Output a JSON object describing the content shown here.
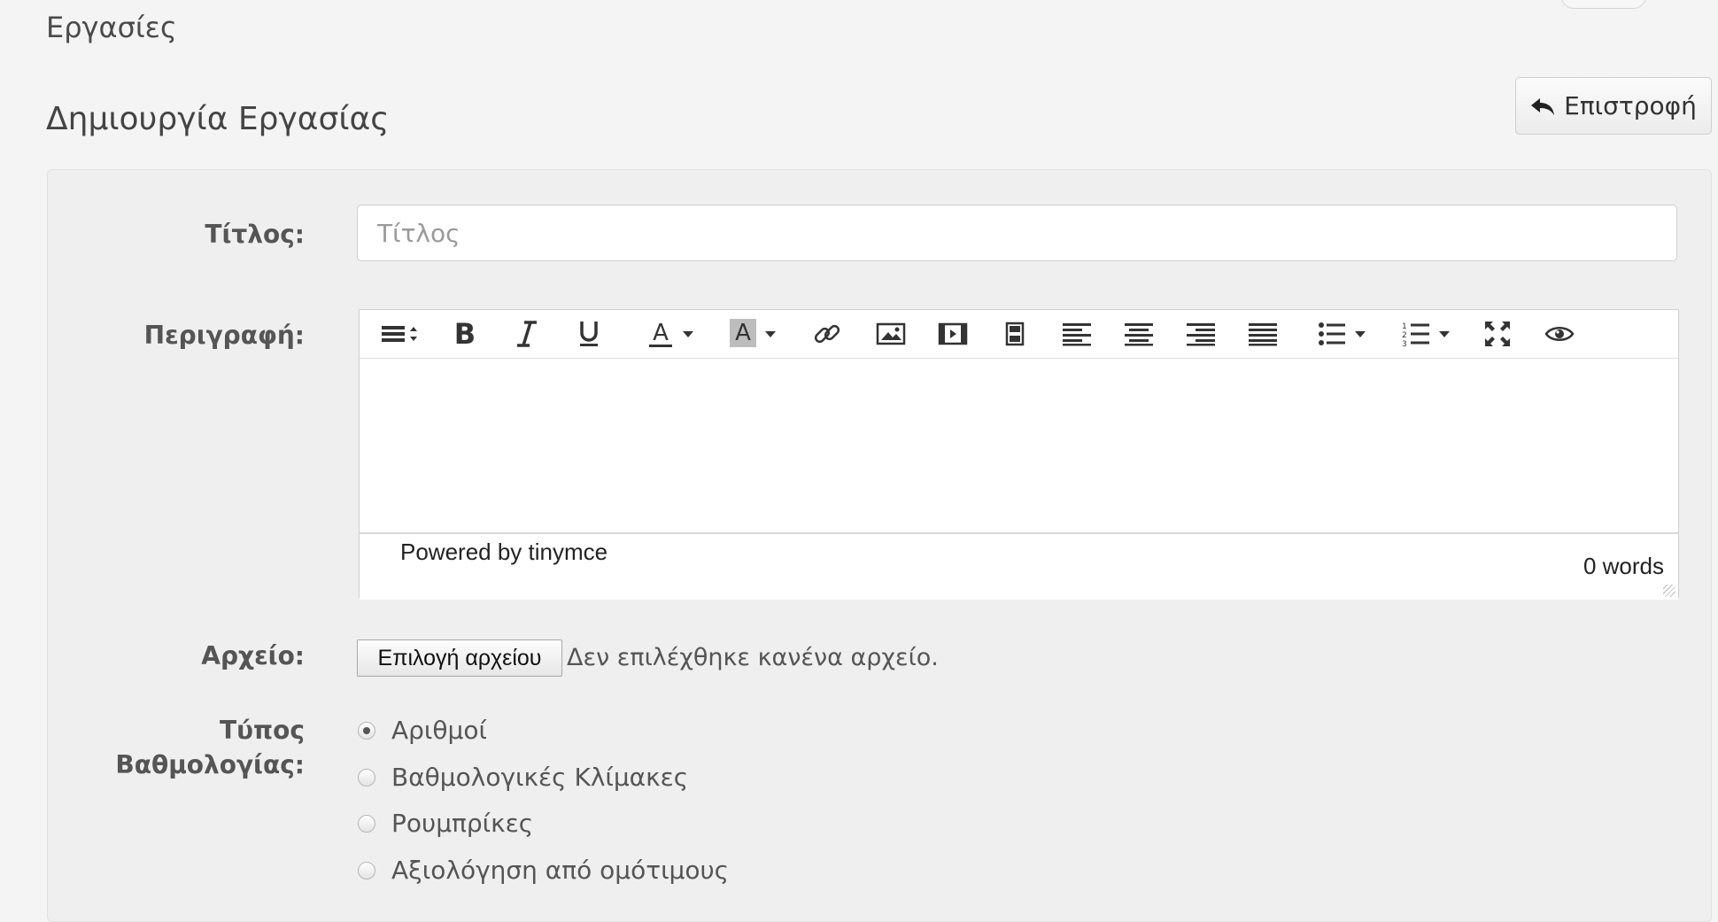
{
  "header": {
    "section_title": "Εργασίες",
    "page_title": "Δημιουργία Εργασίας",
    "back_label": "Επιστροφή"
  },
  "form": {
    "title_label": "Τίτλος:",
    "title_placeholder": "Τίτλος",
    "title_value": "",
    "description_label": "Περιγραφή:",
    "file_label": "Αρχείο:",
    "file_button": "Επιλογή αρχείου",
    "file_status": "Δεν επιλέχθηκε κανένα αρχείο.",
    "grading_label_line1": "Τύπος",
    "grading_label_line2": "Βαθμολογίας:",
    "grading_options": [
      {
        "label": "Αριθμοί",
        "selected": true
      },
      {
        "label": "Βαθμολογικές Κλίμακες",
        "selected": false
      },
      {
        "label": "Ρουμπρίκες",
        "selected": false
      },
      {
        "label": "Αξιολόγηση από ομότιμους",
        "selected": false
      }
    ]
  },
  "editor": {
    "toolbar_icons": [
      "format-menu-icon",
      "bold-icon",
      "italic-icon",
      "underline-icon",
      "text-color-icon",
      "background-color-icon",
      "link-icon",
      "image-icon",
      "media-icon",
      "file-icon",
      "align-left-icon",
      "align-center-icon",
      "align-right-icon",
      "align-justify-icon",
      "bullet-list-icon",
      "numbered-list-icon",
      "fullscreen-icon",
      "preview-icon"
    ],
    "powered_by": "Powered by tinymce",
    "word_count": "0 words"
  },
  "colors": {
    "page_bg": "#f4f4f4",
    "panel_bg": "#efefef",
    "text": "#555555"
  }
}
